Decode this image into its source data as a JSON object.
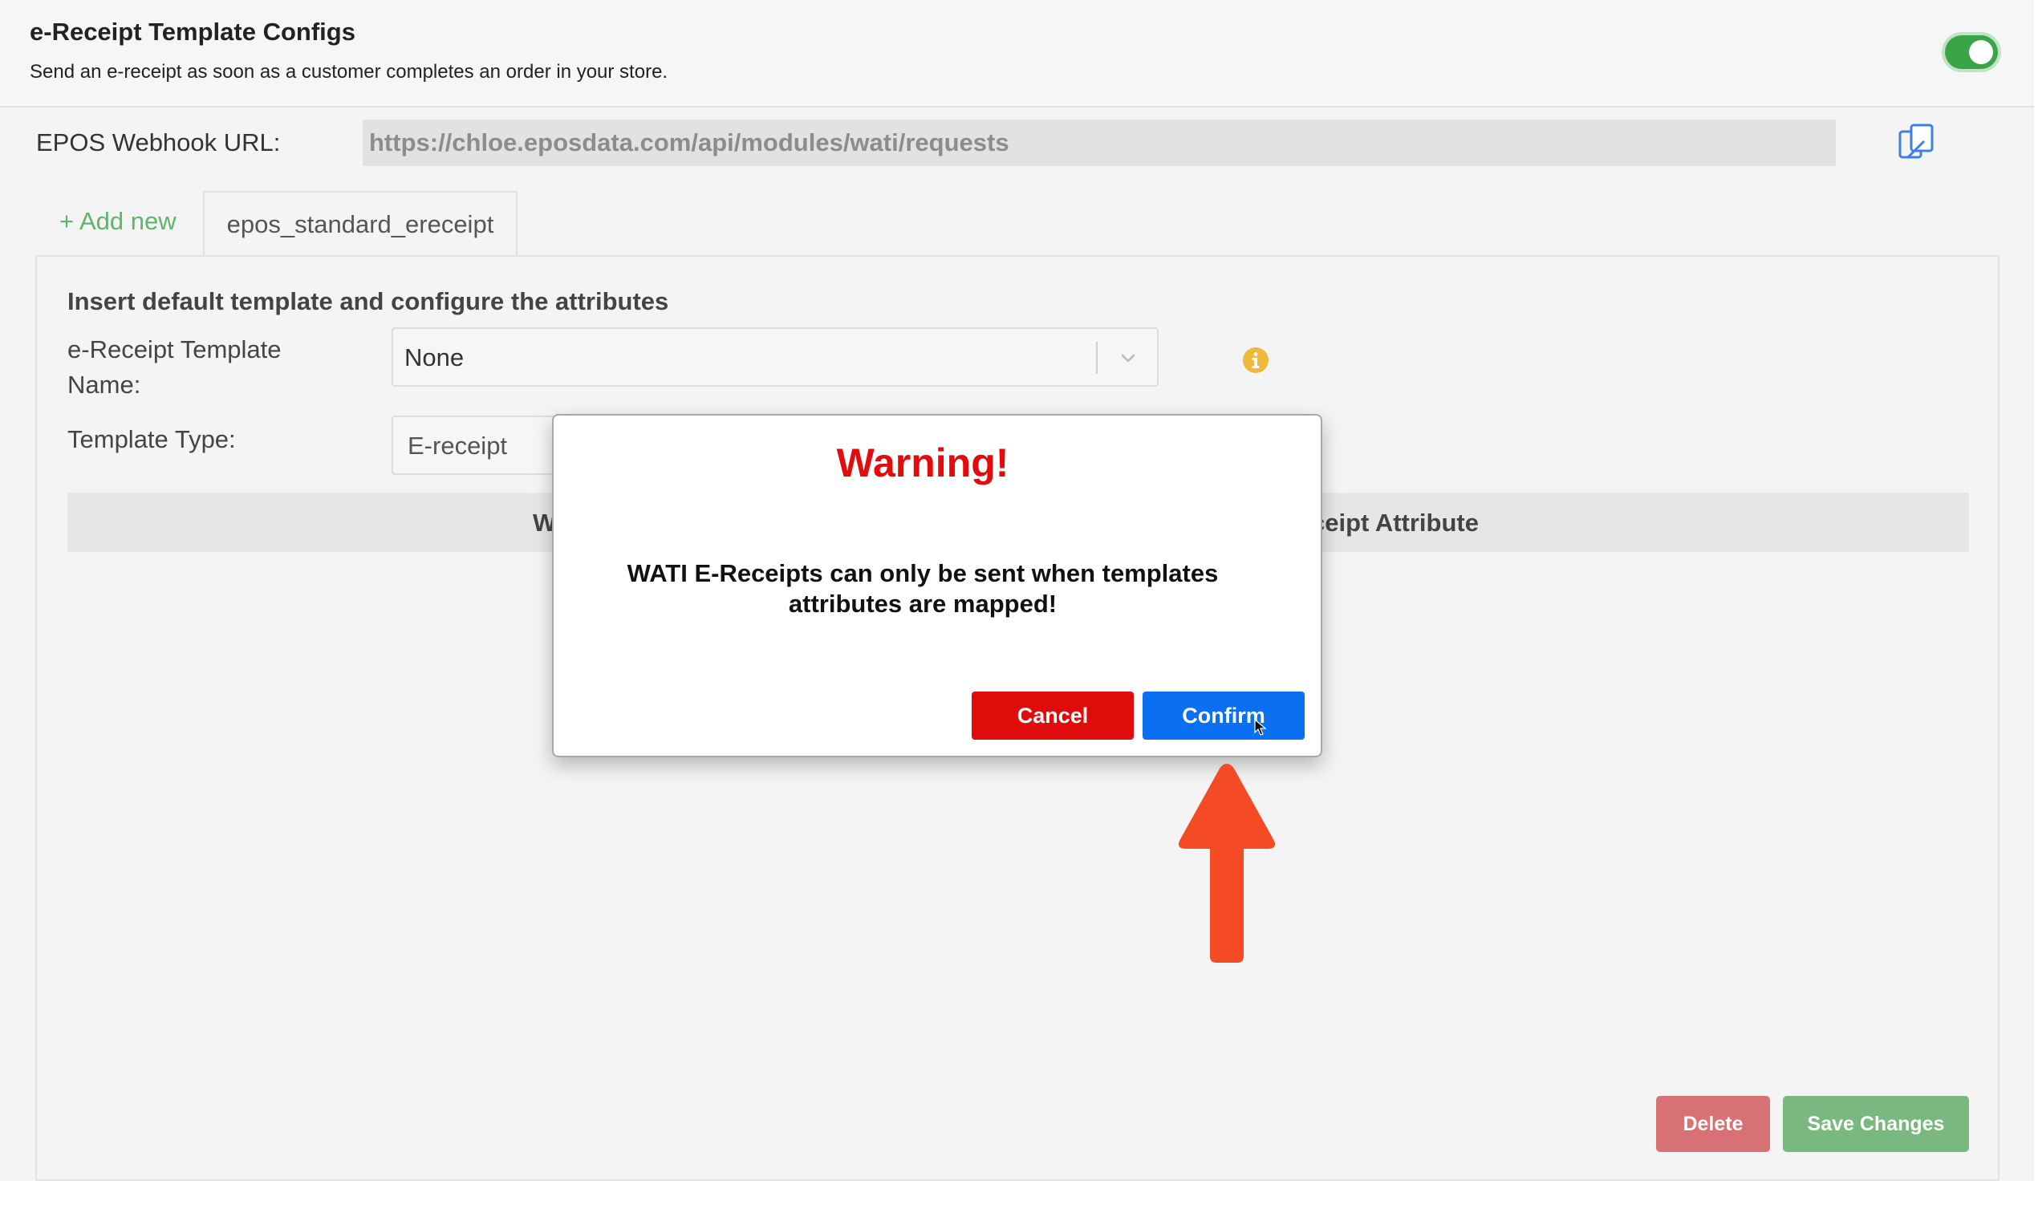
{
  "header": {
    "title": "e-Receipt Template Configs",
    "description": "Send an e-receipt as soon as a customer completes an order in your store.",
    "toggle_on": true,
    "toggle_color": "#3aa447"
  },
  "webhook": {
    "label": "EPOS Webhook URL:",
    "url": "https://chloe.eposdata.com/api/modules/wati/requests",
    "copy_icon": "copy-icon"
  },
  "tabs": {
    "add_label": "+ Add new",
    "items": [
      {
        "label": "epos_standard_ereceipt"
      }
    ]
  },
  "panel": {
    "heading": "Insert default template and configure the attributes",
    "template_name_label": "e-Receipt Template Name:",
    "template_name_value": "None",
    "template_type_label": "Template Type:",
    "template_type_value": "E-receipt",
    "table_headers": [
      "W",
      "ceipt Attribute"
    ],
    "delete_label": "Delete",
    "save_label": "Save Changes"
  },
  "modal": {
    "title": "Warning!",
    "message": "WATI E-Receipts can only be sent when templates attributes are mapped!",
    "cancel_label": "Cancel",
    "confirm_label": "Confirm"
  },
  "colors": {
    "warning_red": "#e30b0b",
    "confirm_blue": "#0a6ff0",
    "arrow_red": "#f44a25"
  }
}
